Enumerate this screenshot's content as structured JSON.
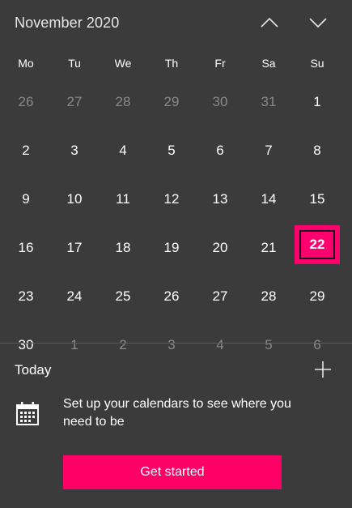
{
  "header": {
    "title": "November 2020",
    "prev_icon": "chevron-up-icon",
    "next_icon": "chevron-down-icon"
  },
  "weekdays": [
    "Mo",
    "Tu",
    "We",
    "Th",
    "Fr",
    "Sa",
    "Su"
  ],
  "days": [
    {
      "label": "26",
      "current_month": false
    },
    {
      "label": "27",
      "current_month": false
    },
    {
      "label": "28",
      "current_month": false
    },
    {
      "label": "29",
      "current_month": false
    },
    {
      "label": "30",
      "current_month": false
    },
    {
      "label": "31",
      "current_month": false
    },
    {
      "label": "1",
      "current_month": true
    },
    {
      "label": "2",
      "current_month": true
    },
    {
      "label": "3",
      "current_month": true
    },
    {
      "label": "4",
      "current_month": true
    },
    {
      "label": "5",
      "current_month": true
    },
    {
      "label": "6",
      "current_month": true
    },
    {
      "label": "7",
      "current_month": true
    },
    {
      "label": "8",
      "current_month": true
    },
    {
      "label": "9",
      "current_month": true
    },
    {
      "label": "10",
      "current_month": true
    },
    {
      "label": "11",
      "current_month": true
    },
    {
      "label": "12",
      "current_month": true
    },
    {
      "label": "13",
      "current_month": true
    },
    {
      "label": "14",
      "current_month": true
    },
    {
      "label": "15",
      "current_month": true
    },
    {
      "label": "16",
      "current_month": true
    },
    {
      "label": "17",
      "current_month": true
    },
    {
      "label": "18",
      "current_month": true
    },
    {
      "label": "19",
      "current_month": true
    },
    {
      "label": "20",
      "current_month": true
    },
    {
      "label": "21",
      "current_month": true
    },
    {
      "label": "22",
      "current_month": true,
      "today": true
    },
    {
      "label": "23",
      "current_month": true
    },
    {
      "label": "24",
      "current_month": true
    },
    {
      "label": "25",
      "current_month": true
    },
    {
      "label": "26",
      "current_month": true
    },
    {
      "label": "27",
      "current_month": true
    },
    {
      "label": "28",
      "current_month": true
    },
    {
      "label": "29",
      "current_month": true
    },
    {
      "label": "30",
      "current_month": true
    },
    {
      "label": "1",
      "current_month": false
    },
    {
      "label": "2",
      "current_month": false
    },
    {
      "label": "3",
      "current_month": false
    },
    {
      "label": "4",
      "current_month": false
    },
    {
      "label": "5",
      "current_month": false
    },
    {
      "label": "6",
      "current_month": false
    }
  ],
  "agenda": {
    "label": "Today",
    "add_icon": "plus-icon",
    "calendar_icon": "calendar-icon",
    "message": "Set up your calendars to see where you need to be",
    "cta_label": "Get started"
  },
  "colors": {
    "background": "#3b3b3b",
    "accent": "#ff0066",
    "muted_text": "#8a8a8a"
  }
}
